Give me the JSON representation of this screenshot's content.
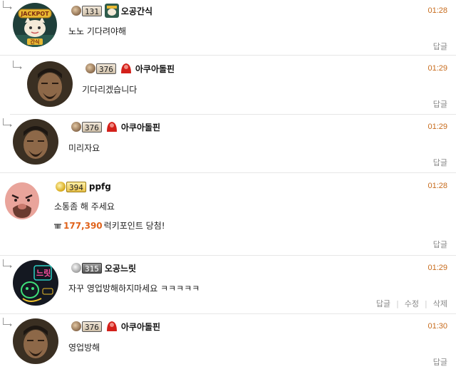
{
  "actions": {
    "reply": "답글",
    "edit": "수정",
    "delete": "삭제"
  },
  "comments": [
    {
      "level": "131",
      "nick": "오공간식",
      "time": "01:28",
      "text": "노노 기다려야해",
      "avatar_text": {
        "top": "JACKPOT",
        "bottom": "간식"
      }
    },
    {
      "level": "376",
      "nick": "아쿠아돌핀",
      "time": "01:29",
      "text": "기다리겠습니다"
    },
    {
      "level": "376",
      "nick": "아쿠아돌핀",
      "time": "01:29",
      "text": "미리자요"
    },
    {
      "level": "394",
      "nick": "ppfg",
      "time": "01:28",
      "text": "소통좀 해 주세요",
      "point_amount": "177,390",
      "point_text": "럭키포인트 당첨!"
    },
    {
      "level": "315",
      "nick": "오공느릿",
      "time": "01:29",
      "text": "자꾸 영업방해하지마세요 ㅋㅋㅋㅋㅋ",
      "avatar_text": {
        "top": "느릿"
      }
    },
    {
      "level": "376",
      "nick": "아쿠아돌핀",
      "time": "01:30",
      "text": "영업방해"
    }
  ],
  "colors": {
    "time": "#c76b1c",
    "point_amount": "#e0621a",
    "divider": "#e6e6e6"
  }
}
